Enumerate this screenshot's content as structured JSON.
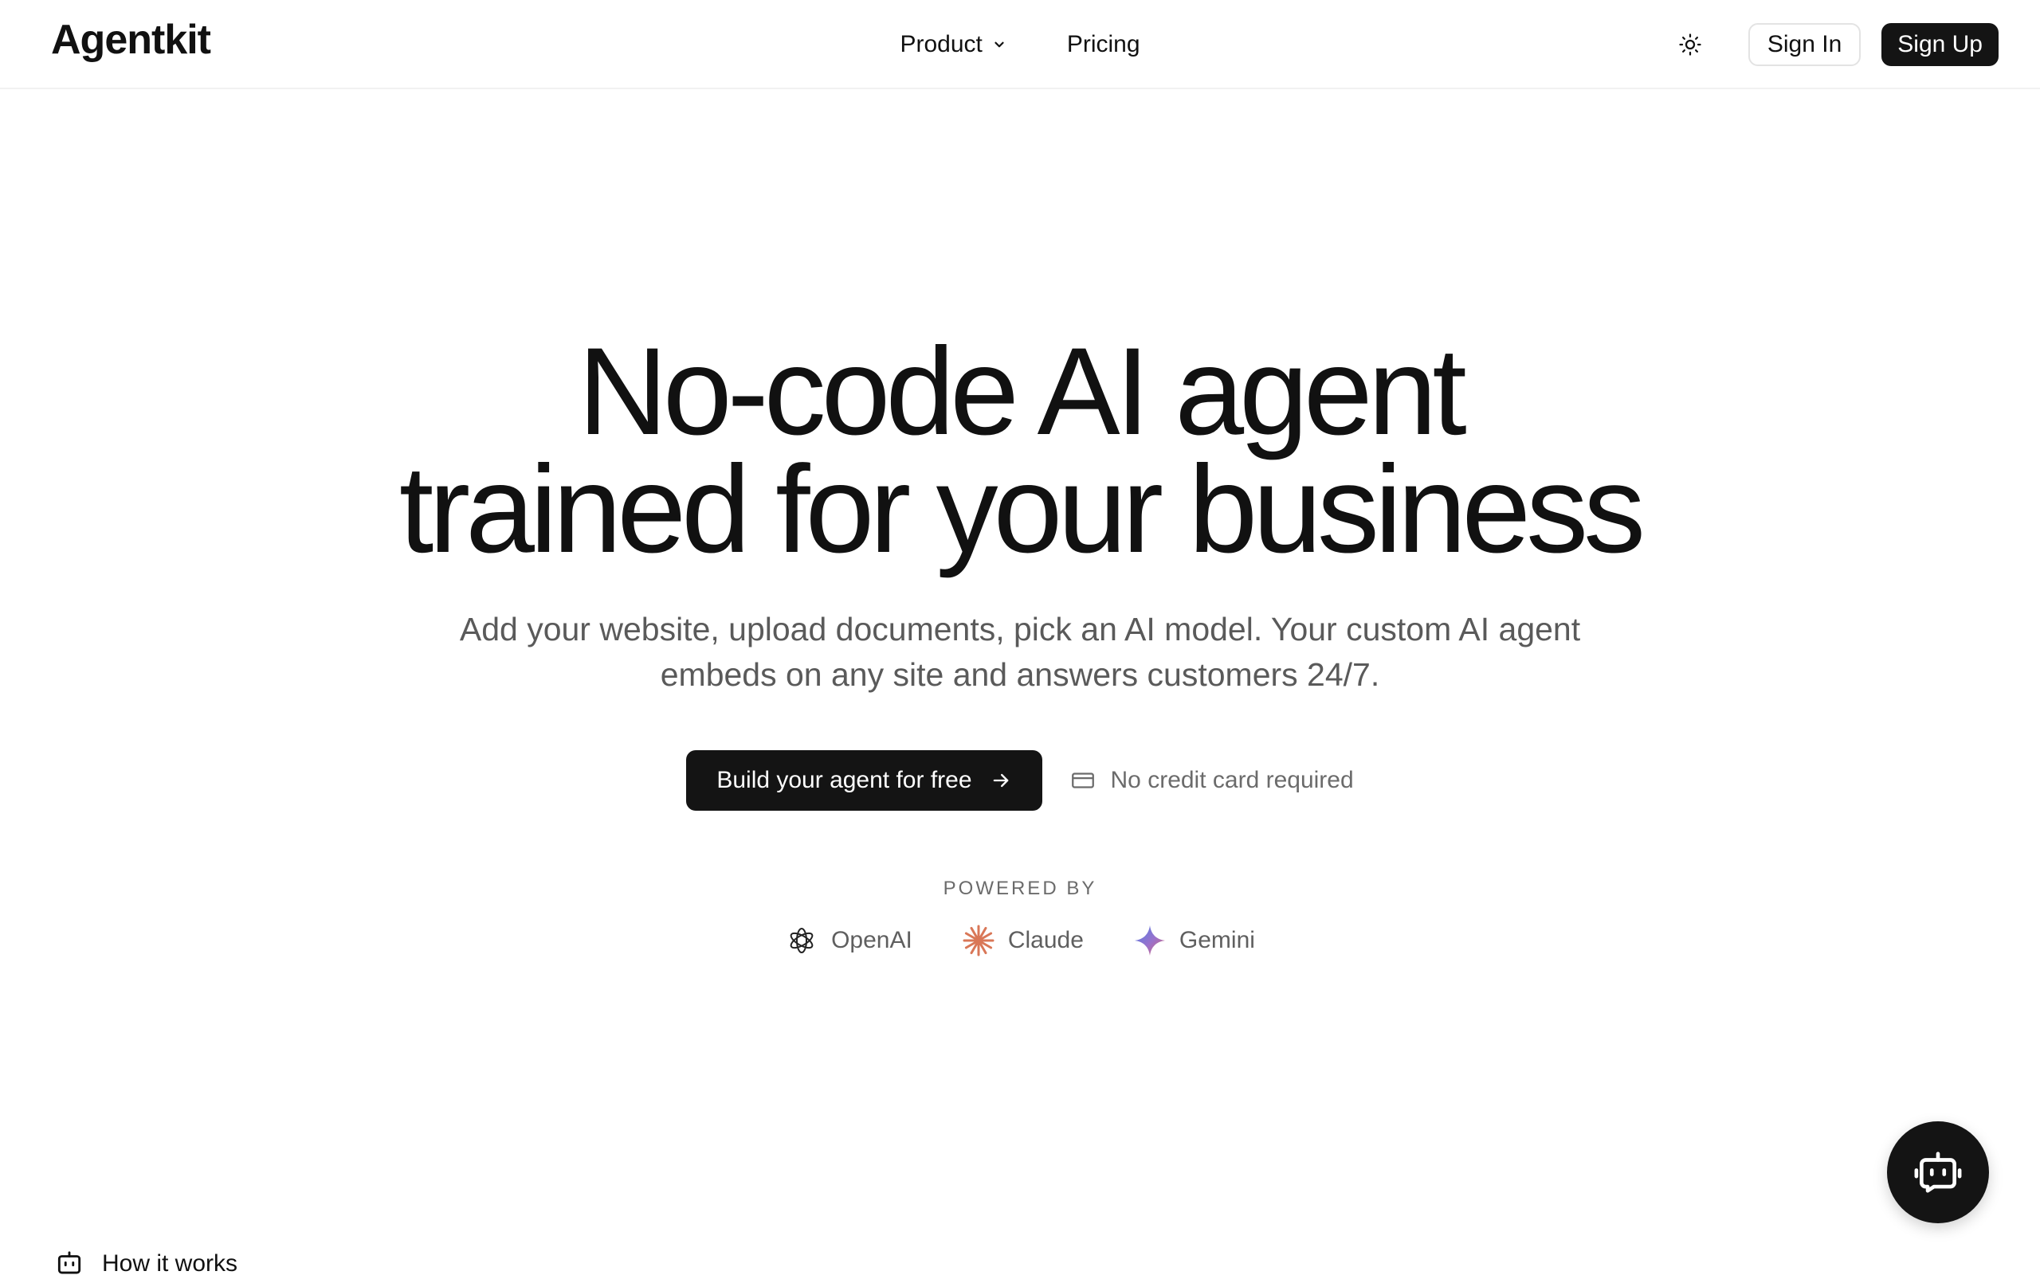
{
  "header": {
    "logo": "Agentkit",
    "nav": [
      {
        "label": "Product",
        "has_dropdown": true
      },
      {
        "label": "Pricing",
        "has_dropdown": false
      }
    ],
    "theme_icon": "sun-icon",
    "sign_in_label": "Sign In",
    "sign_up_label": "Sign Up"
  },
  "hero": {
    "title_line1": "No-code AI agent",
    "title_line2": "trained for your business",
    "subtitle_line1": "Add your website, upload documents, pick an AI model. Your custom AI agent",
    "subtitle_line2": "embeds on any site and answers customers 24/7.",
    "cta_label": "Build your agent for free",
    "cta_icon": "arrow-right-icon",
    "note_icon": "credit-card-icon",
    "note_text": "No credit card required"
  },
  "powered_by": {
    "label": "POWERED BY",
    "providers": [
      {
        "name": "OpenAI",
        "icon": "openai-icon"
      },
      {
        "name": "Claude",
        "icon": "claude-icon",
        "color": "#d97757"
      },
      {
        "name": "Gemini",
        "icon": "gemini-icon",
        "color": "#8a6fe0"
      }
    ]
  },
  "chat_widget": {
    "icon": "bot-icon"
  },
  "section": {
    "how_it_works_label": "How it works",
    "icon": "bot-icon"
  },
  "colors": {
    "text": "#111111",
    "muted": "#5a5a5a",
    "dark_button": "#141414"
  }
}
